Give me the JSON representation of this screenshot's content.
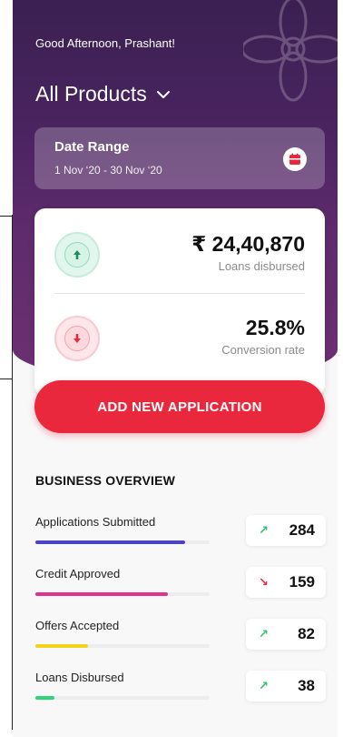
{
  "header": {
    "greeting": "Good Afternoon, Prashant!",
    "product_selector": "All Products",
    "chevron_icon": "chevron-down-icon"
  },
  "date_range": {
    "title": "Date Range",
    "value": "1 Nov ‘20 - 30 Nov ‘20",
    "icon": "calendar-icon"
  },
  "stats": [
    {
      "value": "₹ 24,40,870",
      "label": "Loans disbursed",
      "trend": "up",
      "icon": "arrow-up-icon",
      "color": "#1f8a5a"
    },
    {
      "value": "25.8%",
      "label": "Conversion rate",
      "trend": "down",
      "icon": "arrow-down-icon",
      "color": "#e9283d"
    }
  ],
  "cta": {
    "label": "ADD NEW APPLICATION",
    "color": "#e9283d"
  },
  "overview": {
    "title": "BUSINESS OVERVIEW",
    "items": [
      {
        "name": "Applications Submitted",
        "count": "284",
        "trend": "up",
        "arrow": "↗",
        "bar_fraction": 0.86,
        "bar_color": "#4a43c6"
      },
      {
        "name": "Credit Approved",
        "count": "159",
        "trend": "down",
        "arrow": "↘",
        "bar_fraction": 0.76,
        "bar_color": "#e0338f"
      },
      {
        "name": "Offers Accepted",
        "count": "82",
        "trend": "up",
        "arrow": "↗",
        "bar_fraction": 0.3,
        "bar_color": "#f2d21b"
      },
      {
        "name": "Loans Disbursed",
        "count": "38",
        "trend": "up",
        "arrow": "↗",
        "bar_fraction": 0.11,
        "bar_color": "#2ed47a"
      }
    ]
  },
  "colors": {
    "up": "#2ec36f",
    "down": "#e9283d",
    "hero_top": "#3b2052",
    "hero_bottom": "#6d3072"
  }
}
